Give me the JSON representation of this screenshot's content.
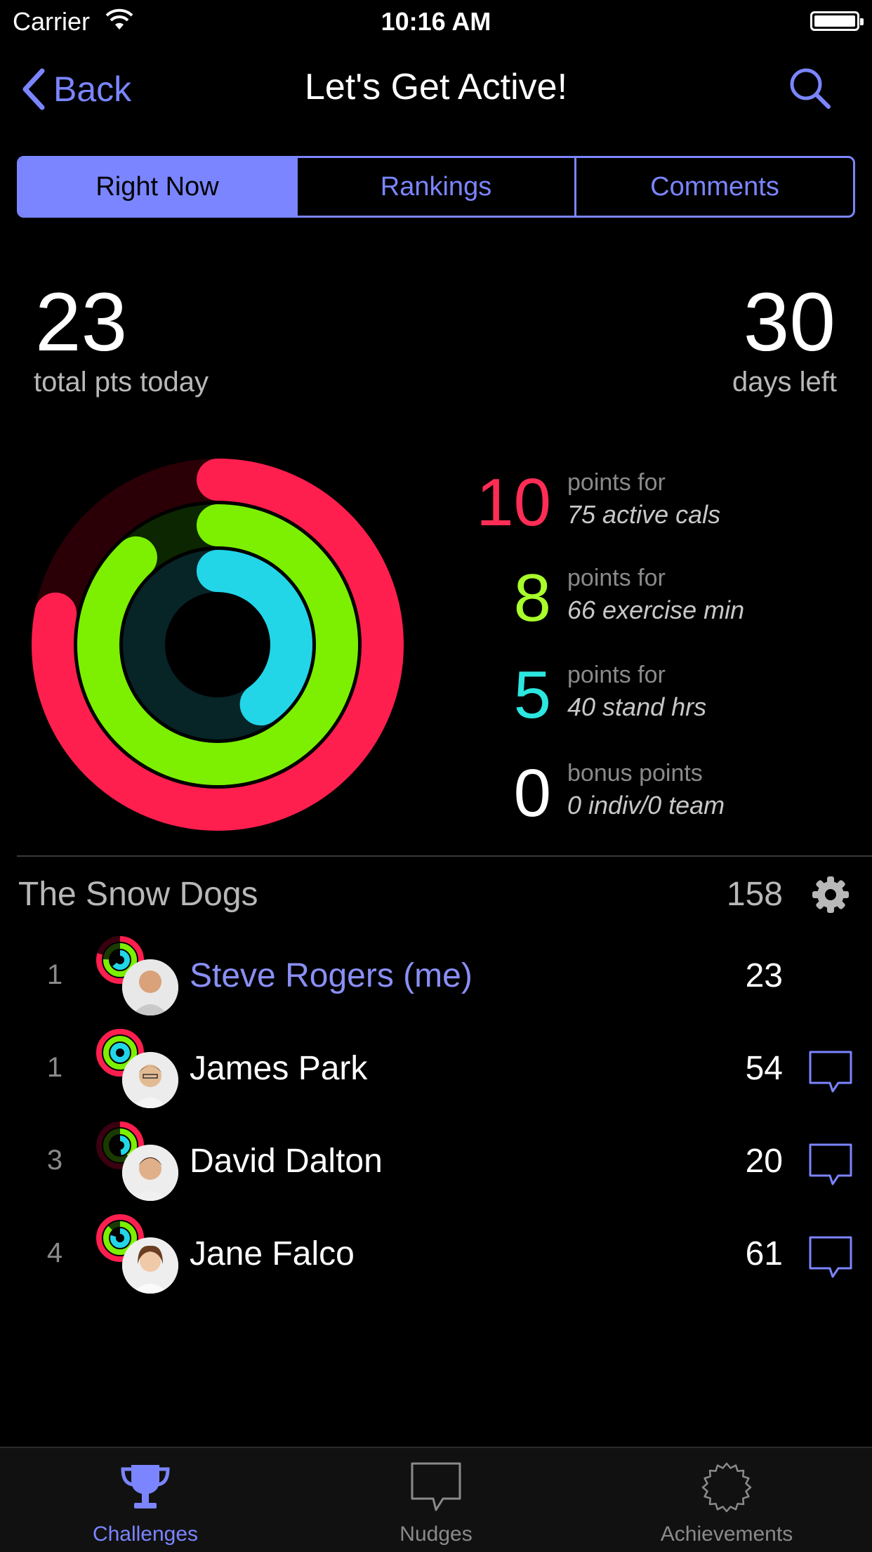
{
  "status_bar": {
    "carrier": "Carrier",
    "time": "10:16 AM"
  },
  "nav": {
    "back_label": "Back",
    "title": "Let's Get Active!"
  },
  "segments": [
    {
      "label": "Right Now",
      "active": true
    },
    {
      "label": "Rankings",
      "active": false
    },
    {
      "label": "Comments",
      "active": false
    }
  ],
  "summary": {
    "total_points": "23",
    "total_points_label": "total pts today",
    "days_left": "30",
    "days_left_label": "days left"
  },
  "rings": {
    "move_progress": 0.78,
    "exercise_progress": 0.88,
    "stand_progress": 0.4
  },
  "points_breakdown": [
    {
      "value": "10",
      "top": "points for",
      "bottom": "75 active cals",
      "color": "#ff2d55"
    },
    {
      "value": "8",
      "top": "points for",
      "bottom": "66 exercise min",
      "color": "#a8ff2a"
    },
    {
      "value": "5",
      "top": "points for",
      "bottom": "40 stand hrs",
      "color": "#2ce6e0"
    },
    {
      "value": "0",
      "top": "bonus points",
      "bottom": "0 indiv/0 team",
      "color": "#ffffff"
    }
  ],
  "team": {
    "name": "The Snow Dogs",
    "score": "158",
    "members": [
      {
        "rank": "1",
        "name": "Steve Rogers (me)",
        "score": "23",
        "is_me": true,
        "nudge": false
      },
      {
        "rank": "1",
        "name": "James Park",
        "score": "54",
        "is_me": false,
        "nudge": true
      },
      {
        "rank": "3",
        "name": "David Dalton",
        "score": "20",
        "is_me": false,
        "nudge": true
      },
      {
        "rank": "4",
        "name": "Jane Falco",
        "score": "61",
        "is_me": false,
        "nudge": true
      }
    ]
  },
  "tabbar": [
    {
      "label": "Challenges",
      "icon": "trophy-icon",
      "active": true
    },
    {
      "label": "Nudges",
      "icon": "speech-bubble-icon",
      "active": false
    },
    {
      "label": "Achievements",
      "icon": "badge-icon",
      "active": false
    }
  ],
  "colors": {
    "accent": "#7b85ff",
    "move": "#ff2d55",
    "exercise": "#a8ff2a",
    "stand": "#2ce6e0"
  }
}
